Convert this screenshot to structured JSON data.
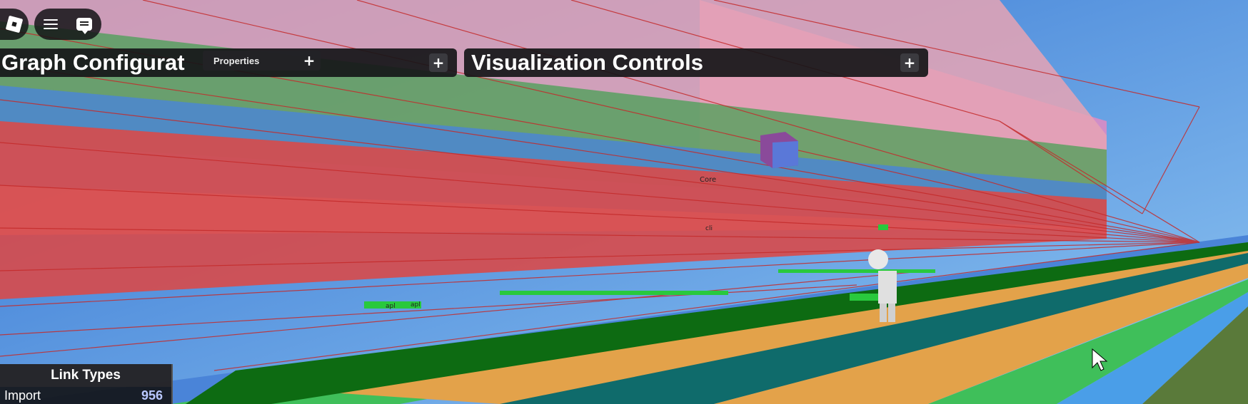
{
  "app": {
    "left_rail": {
      "logo_icon": "roblox-logo-icon",
      "menu_icon": "hamburger-menu-icon",
      "chat_icon": "chat-icon"
    }
  },
  "panels": {
    "graph_configuration": {
      "title": "Graph Configurat",
      "expand_label": "+"
    },
    "properties": {
      "label": "Properties",
      "expand_label": "+"
    },
    "visualization_controls": {
      "title": "Visualization Controls",
      "expand_label": "+"
    }
  },
  "link_types": {
    "title": "Link Types",
    "rows": [
      {
        "name": "Import",
        "count": "956"
      }
    ]
  },
  "scene_labels": [
    "Core",
    "cli",
    "apl",
    "apl"
  ],
  "colors": {
    "sky": "#4a8fd8",
    "link_red": "#d43a3a",
    "link_green": "#3fbf5a",
    "lane_orange": "#e3a24a",
    "lane_teal": "#0f6b6b",
    "lane_dark_green": "#0d6b12",
    "panel_bg": "#161618"
  }
}
